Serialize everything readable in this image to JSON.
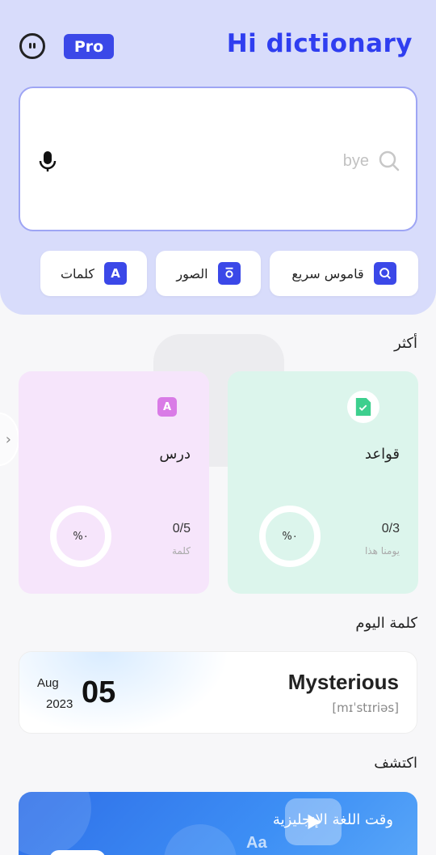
{
  "header": {
    "pro_badge": "Pro",
    "app_title": "Hi dictionary"
  },
  "search": {
    "placeholder": "bye"
  },
  "quick_actions": [
    {
      "label": "قاموس سريع",
      "icon": "search-icon"
    },
    {
      "label": "الصور",
      "icon": "camera-icon"
    },
    {
      "label": "كلمات",
      "icon": "letter-a-icon"
    }
  ],
  "more": {
    "title": "أكثر",
    "cards": [
      {
        "title": "قواعد",
        "count": "0/3",
        "sub": "يومنا هذا",
        "percent": "%٠",
        "progress": 0,
        "icon": "document-icon"
      },
      {
        "title": "درس",
        "count": "0/5",
        "sub": "كلمة",
        "percent": "%٠",
        "progress": 0,
        "icon": "letter-a-icon"
      }
    ]
  },
  "word_of_day": {
    "title": "كلمة اليوم",
    "month": "Aug",
    "year": "2023",
    "day": "05",
    "word": "Mysterious",
    "phonetic": "[mɪˈstɪriəs]"
  },
  "discover": {
    "title": "اكتشف",
    "banner_text": "وقت اللغة الإنجليزية",
    "banner_glyph": "Aa"
  },
  "colors": {
    "accent": "#3b48e8",
    "header_bg": "#d8dcfb",
    "grammar_card": "#dcf5ec",
    "lesson_card": "#f6e5fb"
  }
}
